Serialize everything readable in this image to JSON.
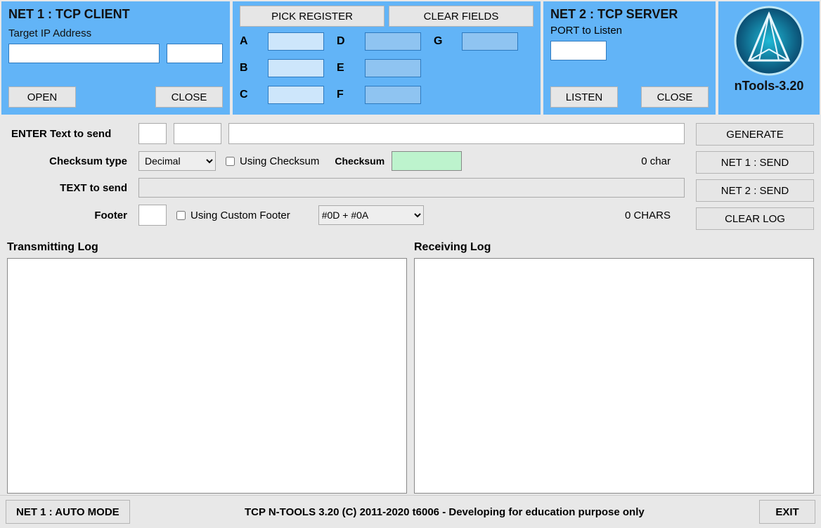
{
  "net1": {
    "title": "NET 1 : TCP CLIENT",
    "ip_label": "Target IP Address",
    "ip_value": "",
    "port_value": "",
    "open_label": "OPEN",
    "close_label": "CLOSE"
  },
  "registers": {
    "pick_label": "PICK REGISTER",
    "clear_label": "CLEAR FIELDS",
    "labels": {
      "a": "A",
      "b": "B",
      "c": "C",
      "d": "D",
      "e": "E",
      "f": "F",
      "g": "G"
    },
    "values": {
      "a": "",
      "b": "",
      "c": "",
      "d": "",
      "e": "",
      "f": "",
      "g": ""
    }
  },
  "net2": {
    "title": "NET 2 : TCP SERVER",
    "port_label": "PORT to Listen",
    "port_value": "",
    "listen_label": "LISTEN",
    "close_label": "CLOSE"
  },
  "logo": {
    "title": "nTools-3.20"
  },
  "mid": {
    "enter_label": "ENTER Text to send",
    "pre1": "",
    "pre2": "",
    "text_value": "",
    "chktype_label": "Checksum type",
    "chktype_value": "Decimal",
    "using_checksum_label": "Using Checksum",
    "checksum_label": "Checksum",
    "checksum_value": "",
    "char_count": "0 char",
    "text_to_send_label": "TEXT to send",
    "text_to_send_value": "",
    "footer_label": "Footer",
    "footer_value": "",
    "using_footer_label": "Using Custom Footer",
    "footer_select_value": "#0D + #0A",
    "chars_count": "0 CHARS"
  },
  "actions": {
    "generate": "GENERATE",
    "net1send": "NET 1 : SEND",
    "net2send": "NET 2 : SEND",
    "clearlog": "CLEAR LOG"
  },
  "logs": {
    "tx_title": "Transmitting Log",
    "rx_title": "Receiving Log"
  },
  "status": {
    "mode_btn": "NET 1 : AUTO MODE",
    "copyright": "TCP N-TOOLS 3.20 (C) 2011-2020 t6006 - Developing for education purpose only",
    "exit": "EXIT"
  }
}
